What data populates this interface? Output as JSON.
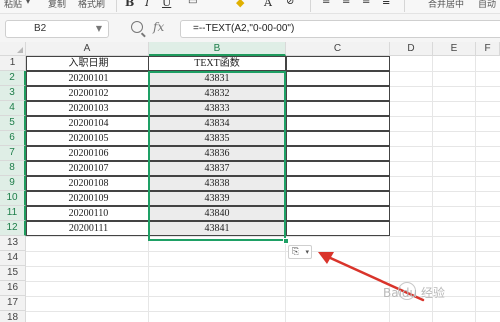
{
  "toolbar": {
    "paste_label": "粘贴",
    "copy_label": "复制",
    "format_painter_label": "格式刷",
    "merge_center_label": "合并居中",
    "wrap_label": "自动"
  },
  "formula_bar": {
    "name_box": "B2",
    "fx_label": "fx",
    "formula": "=--TEXT(A2,\"0-00-00\")"
  },
  "columns": [
    "A",
    "B",
    "C",
    "D",
    "E",
    "F"
  ],
  "rows": [
    "1",
    "2",
    "3",
    "4",
    "5",
    "6",
    "7",
    "8",
    "9",
    "10",
    "11",
    "12",
    "13",
    "14",
    "15",
    "16",
    "17",
    "18"
  ],
  "table": {
    "header_a": "入职日期",
    "header_b": "TEXT函数",
    "rows": [
      {
        "a": "20200101",
        "b": "43831"
      },
      {
        "a": "20200102",
        "b": "43832"
      },
      {
        "a": "20200103",
        "b": "43833"
      },
      {
        "a": "20200104",
        "b": "43834"
      },
      {
        "a": "20200105",
        "b": "43835"
      },
      {
        "a": "20200106",
        "b": "43836"
      },
      {
        "a": "20200107",
        "b": "43837"
      },
      {
        "a": "20200108",
        "b": "43838"
      },
      {
        "a": "20200109",
        "b": "43839"
      },
      {
        "a": "20200110",
        "b": "43840"
      },
      {
        "a": "20200111",
        "b": "43841"
      }
    ]
  },
  "selection": {
    "active_column": "B",
    "range": "B2:B12"
  },
  "watermark": "Baidu 经验",
  "colors": {
    "selection": "#1ea065",
    "arrow": "#d9342b"
  }
}
